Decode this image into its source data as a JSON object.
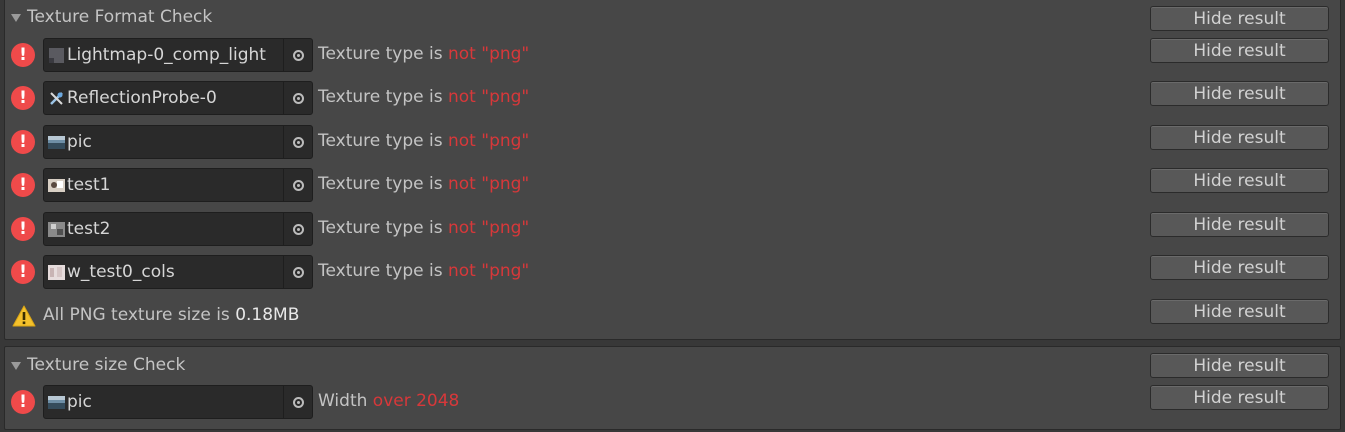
{
  "sections": [
    {
      "title": "Texture Format Check",
      "hide_label": "Hide result",
      "rows": [
        {
          "asset": "Lightmap-0_comp_light",
          "thumb": "lightmap-icon",
          "msg_prefix": "Texture type is ",
          "msg_highlight": "not \"png\"",
          "hide_label": "Hide result"
        },
        {
          "asset": "ReflectionProbe-0",
          "thumb": "reflection-probe-icon",
          "msg_prefix": "Texture type is ",
          "msg_highlight": "not \"png\"",
          "hide_label": "Hide result"
        },
        {
          "asset": "pic",
          "thumb": "image-thumb-icon",
          "msg_prefix": "Texture type is ",
          "msg_highlight": "not \"png\"",
          "hide_label": "Hide result"
        },
        {
          "asset": "test1",
          "thumb": "image-thumb-icon",
          "msg_prefix": "Texture type is ",
          "msg_highlight": "not \"png\"",
          "hide_label": "Hide result"
        },
        {
          "asset": "test2",
          "thumb": "image-thumb-icon",
          "msg_prefix": "Texture type is ",
          "msg_highlight": "not \"png\"",
          "hide_label": "Hide result"
        },
        {
          "asset": "w_test0_cols",
          "thumb": "image-thumb-icon",
          "msg_prefix": "Texture type is ",
          "msg_highlight": "not \"png\"",
          "hide_label": "Hide result"
        }
      ],
      "warning": {
        "prefix": "All PNG texture size is ",
        "value": "0.18MB",
        "hide_label": "Hide result"
      }
    },
    {
      "title": "Texture size Check",
      "hide_label": "Hide result",
      "rows": [
        {
          "asset": "pic",
          "thumb": "image-thumb-icon",
          "msg_prefix": "Width ",
          "msg_highlight": "over 2048",
          "hide_label": "Hide result"
        }
      ]
    }
  ],
  "colors": {
    "error": "#ef4a4a",
    "warning": "#f4c12c",
    "highlight": "#d7383a",
    "panel": "#474747",
    "field": "#2a2a2a"
  }
}
